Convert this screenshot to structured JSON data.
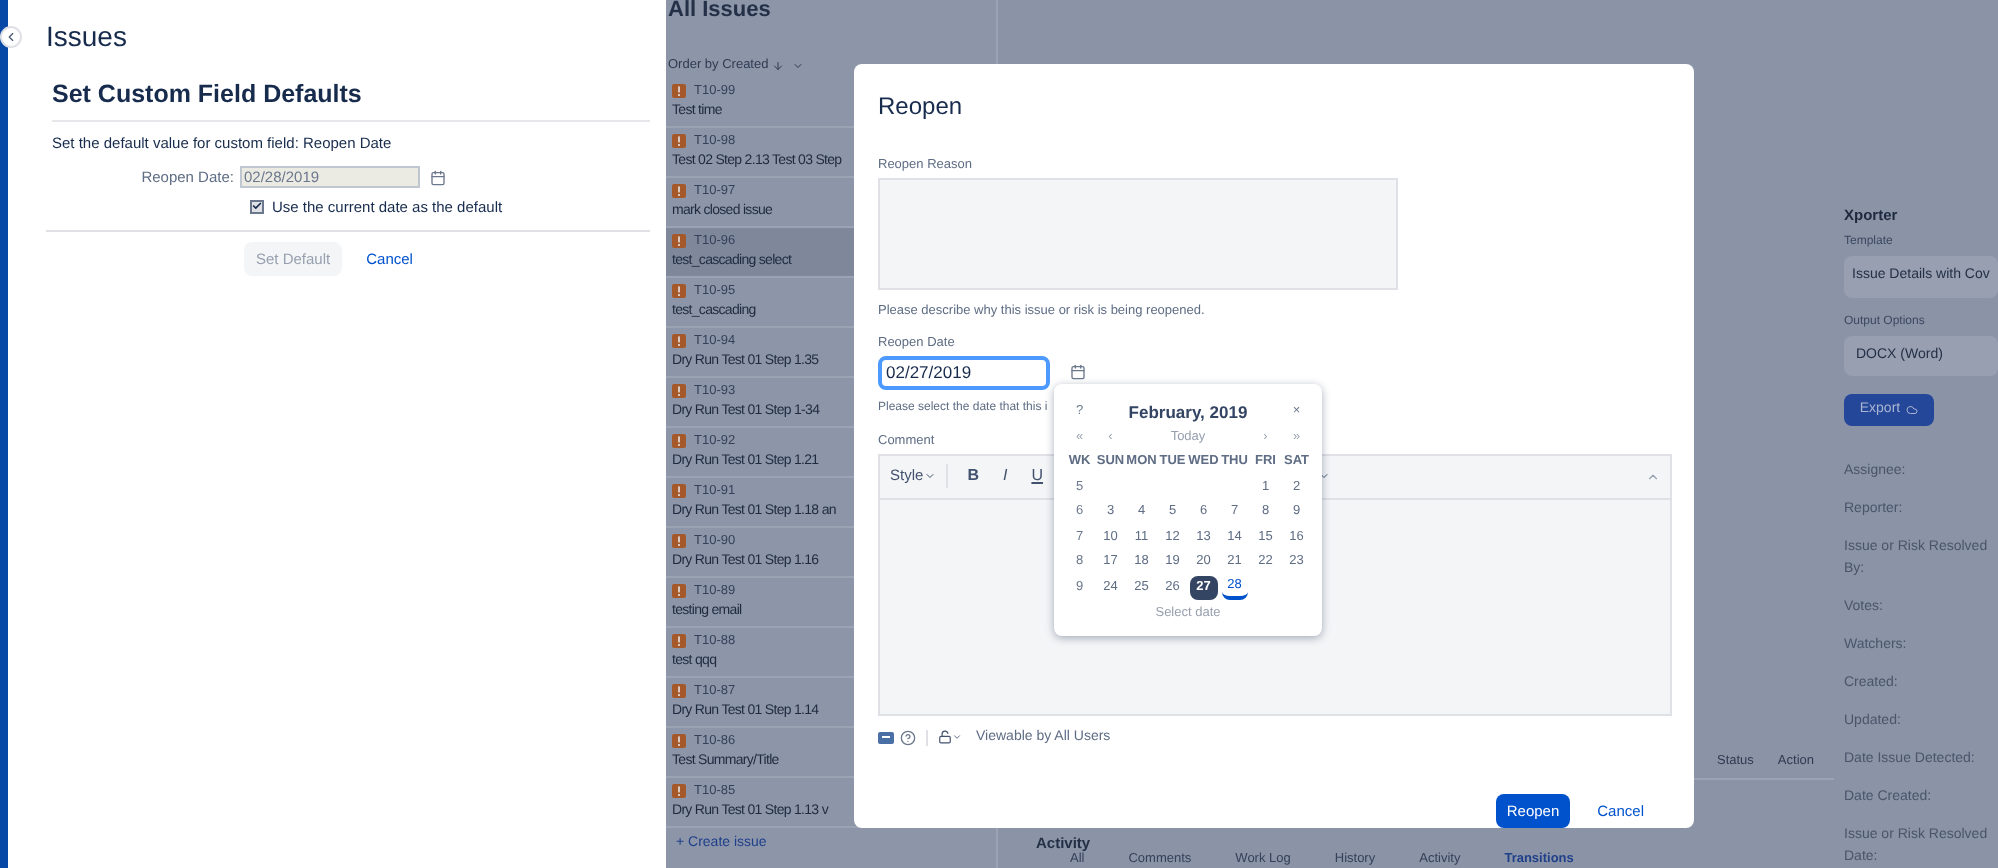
{
  "left_panel": {
    "title": "Issues",
    "section_title": "Set Custom Field Defaults",
    "description": "Set the default value for custom field: Reopen Date",
    "field_label": "Reopen Date:",
    "field_value": "02/28/2019",
    "checkbox": {
      "label": "Use the current date as the default",
      "checked": true
    },
    "buttons": [
      {
        "label": "Set Default",
        "kind": "default"
      },
      {
        "label": "Cancel",
        "kind": "link"
      }
    ]
  },
  "issue_list": {
    "title": "All Issues",
    "order_label": "Order by Created",
    "issues": [
      {
        "key": "T10-99",
        "summary": "Test time",
        "selected": false
      },
      {
        "key": "T10-98",
        "summary": "Test 02 Step 2.13 Test 03 Step",
        "selected": false
      },
      {
        "key": "T10-97",
        "summary": "mark closed issue",
        "selected": false
      },
      {
        "key": "T10-96",
        "summary": "test_cascading select",
        "selected": true
      },
      {
        "key": "T10-95",
        "summary": "test_cascading",
        "selected": false
      },
      {
        "key": "T10-94",
        "summary": "Dry Run Test 01 Step 1.35",
        "selected": false
      },
      {
        "key": "T10-93",
        "summary": "Dry Run Test 01 Step 1-34",
        "selected": false
      },
      {
        "key": "T10-92",
        "summary": "Dry Run Test 01 Step 1.21",
        "selected": false
      },
      {
        "key": "T10-91",
        "summary": "Dry Run Test 01 Step 1.18 an",
        "selected": false
      },
      {
        "key": "T10-90",
        "summary": "Dry Run Test 01 Step 1.16",
        "selected": false
      },
      {
        "key": "T10-89",
        "summary": "testing email",
        "selected": false
      },
      {
        "key": "T10-88",
        "summary": "test qqq",
        "selected": false
      },
      {
        "key": "T10-87",
        "summary": "Dry Run Test 01 Step 1.14",
        "selected": false
      },
      {
        "key": "T10-86",
        "summary": "Test Summary/Title",
        "selected": false
      },
      {
        "key": "T10-85",
        "summary": "Dry Run Test 01 Step 1.13 v",
        "selected": false
      }
    ],
    "create_link": "+ Create issue"
  },
  "issue_table": {
    "columns": [
      "Status",
      "Action"
    ]
  },
  "activity": {
    "title": "Activity",
    "tabs": [
      {
        "label": "All",
        "selected": false
      },
      {
        "label": "Comments",
        "selected": false
      },
      {
        "label": "Work Log",
        "selected": false
      },
      {
        "label": "History",
        "selected": false
      },
      {
        "label": "Activity",
        "selected": false
      },
      {
        "label": "Transitions",
        "selected": true
      }
    ]
  },
  "xporter": {
    "title": "Xporter",
    "template_label": "Template",
    "template_value": "Issue Details with Cov",
    "output_label": "Output Options",
    "output_value": "DOCX (Word)",
    "export_button": "Export"
  },
  "details": [
    "Assignee:",
    "Reporter:",
    "Issue or Risk Resolved By:",
    "Votes:",
    "Watchers:",
    "Created:",
    "Updated:",
    "Date Issue Detected:",
    "Date Created:",
    "Issue or Risk Resolved Date:"
  ],
  "dialog": {
    "title": "Reopen",
    "reason_label": "Reopen Reason",
    "reason_help": "Please describe why this issue or risk is being reopened.",
    "date_label": "Reopen Date",
    "date_value": "02/27/2019",
    "date_help": "Please select the date that this i",
    "comment_label": "Comment",
    "toolbar": [
      {
        "label": "Style",
        "kind": "dropdown"
      },
      {
        "label": "B",
        "kind": "bold"
      },
      {
        "label": "I",
        "kind": "italic"
      },
      {
        "label": "U",
        "kind": "underline"
      }
    ],
    "visibility": "Viewable by All Users",
    "buttons": [
      {
        "label": "Reopen",
        "kind": "primary"
      },
      {
        "label": "Cancel",
        "kind": "link"
      }
    ],
    "calendar": {
      "help": "?",
      "title": "February, 2019",
      "close": "×",
      "nav": [
        "«",
        "‹",
        "Today",
        "›",
        "»"
      ],
      "headers": [
        "WK",
        "SUN",
        "MON",
        "TUE",
        "WED",
        "THU",
        "FRI",
        "SAT"
      ],
      "weeks": [
        {
          "wk": "5",
          "days": [
            {
              "kind": "blank"
            },
            {
              "kind": "blank"
            },
            {
              "kind": "blank"
            },
            {
              "kind": "blank"
            },
            {
              "kind": "blank"
            },
            {
              "kind": "day",
              "label": "1",
              "selected": false,
              "today": false
            },
            {
              "kind": "day",
              "label": "2",
              "selected": false,
              "today": false
            }
          ]
        },
        {
          "wk": "6",
          "days": [
            {
              "label": "3",
              "selected": false,
              "today": false
            },
            {
              "label": "4",
              "selected": false,
              "today": false
            },
            {
              "label": "5",
              "selected": false,
              "today": false
            },
            {
              "label": "6",
              "selected": false,
              "today": false
            },
            {
              "label": "7",
              "selected": false,
              "today": false
            },
            {
              "label": "8",
              "selected": false,
              "today": false
            },
            {
              "label": "9",
              "selected": false,
              "today": false
            }
          ]
        },
        {
          "wk": "7",
          "days": [
            {
              "label": "10",
              "selected": false,
              "today": false
            },
            {
              "label": "11",
              "selected": false,
              "today": false
            },
            {
              "label": "12",
              "selected": false,
              "today": false
            },
            {
              "label": "13",
              "selected": false,
              "today": false
            },
            {
              "label": "14",
              "selected": false,
              "today": false
            },
            {
              "label": "15",
              "selected": false,
              "today": false
            },
            {
              "label": "16",
              "selected": false,
              "today": false
            }
          ]
        },
        {
          "wk": "8",
          "days": [
            {
              "label": "17",
              "selected": false,
              "today": false
            },
            {
              "label": "18",
              "selected": false,
              "today": false
            },
            {
              "label": "19",
              "selected": false,
              "today": false
            },
            {
              "label": "20",
              "selected": false,
              "today": false
            },
            {
              "label": "21",
              "selected": false,
              "today": false
            },
            {
              "label": "22",
              "selected": false,
              "today": false
            },
            {
              "label": "23",
              "selected": false,
              "today": false
            }
          ]
        },
        {
          "wk": "9",
          "days": [
            {
              "label": "24",
              "selected": false,
              "today": false
            },
            {
              "label": "25",
              "selected": false,
              "today": false
            },
            {
              "label": "26",
              "selected": false,
              "today": false
            },
            {
              "label": "27",
              "selected": true,
              "today": false
            },
            {
              "label": "28",
              "selected": false,
              "today": true
            },
            {
              "kind": "blank"
            },
            {
              "kind": "blank"
            }
          ]
        }
      ],
      "footer": "Select date"
    }
  }
}
